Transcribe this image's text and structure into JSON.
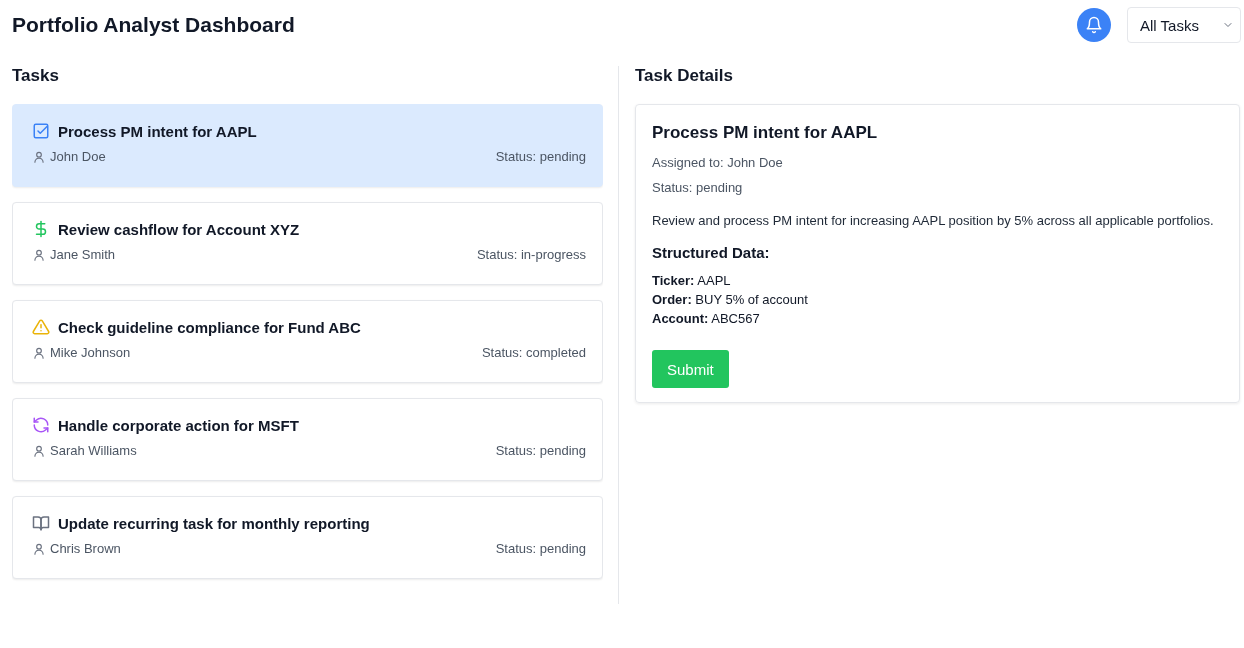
{
  "header": {
    "title": "Portfolio Analyst Dashboard",
    "filter": {
      "value": "All Tasks"
    }
  },
  "tasks": {
    "title": "Tasks",
    "items": [
      {
        "kind": "checklist",
        "title": "Process PM intent for AAPL",
        "assignee": "John Doe",
        "status": "Status: pending",
        "selected": true
      },
      {
        "kind": "dollar",
        "title": "Review cashflow for Account XYZ",
        "assignee": "Jane Smith",
        "status": "Status: in-progress",
        "selected": false
      },
      {
        "kind": "warning",
        "title": "Check guideline compliance for Fund ABC",
        "assignee": "Mike Johnson",
        "status": "Status: completed",
        "selected": false
      },
      {
        "kind": "refresh",
        "title": "Handle corporate action for MSFT",
        "assignee": "Sarah Williams",
        "status": "Status: pending",
        "selected": false
      },
      {
        "kind": "book",
        "title": "Update recurring task for monthly reporting",
        "assignee": "Chris Brown",
        "status": "Status: pending",
        "selected": false
      }
    ]
  },
  "details": {
    "title": "Task Details",
    "task_title": "Process PM intent for AAPL",
    "assigned": "Assigned to: John Doe",
    "status": "Status: pending",
    "description": "Review and process PM intent for increasing AAPL position by 5% across all applicable portfolios.",
    "structured_title": "Structured Data:",
    "fields": [
      "**Ticker:** AAPL",
      "**Order:** BUY 5% of account",
      "**Account:** ABC567"
    ],
    "button": "Submit"
  }
}
